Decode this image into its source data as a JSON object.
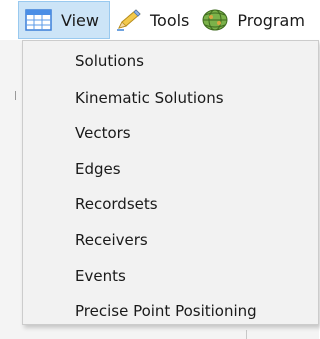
{
  "menubar": {
    "items": [
      {
        "label": "View",
        "icon": "table-icon",
        "active": true
      },
      {
        "label": "Tools",
        "icon": "pencil-icon",
        "active": false
      },
      {
        "label": "Program",
        "icon": "globe-icon",
        "active": false
      }
    ]
  },
  "dropdown": {
    "items": [
      {
        "label": "Solutions"
      },
      {
        "label": "Kinematic Solutions"
      },
      {
        "label": "Vectors"
      },
      {
        "label": "Edges"
      },
      {
        "label": "Recordsets"
      },
      {
        "label": "Receivers"
      },
      {
        "label": "Events"
      },
      {
        "label": "Precise Point Positioning"
      }
    ]
  },
  "colors": {
    "active_menu_bg": "#cce4f7",
    "active_menu_border": "#99c9ef",
    "dropdown_bg": "#f2f2f2",
    "dropdown_border": "#cccccc"
  }
}
